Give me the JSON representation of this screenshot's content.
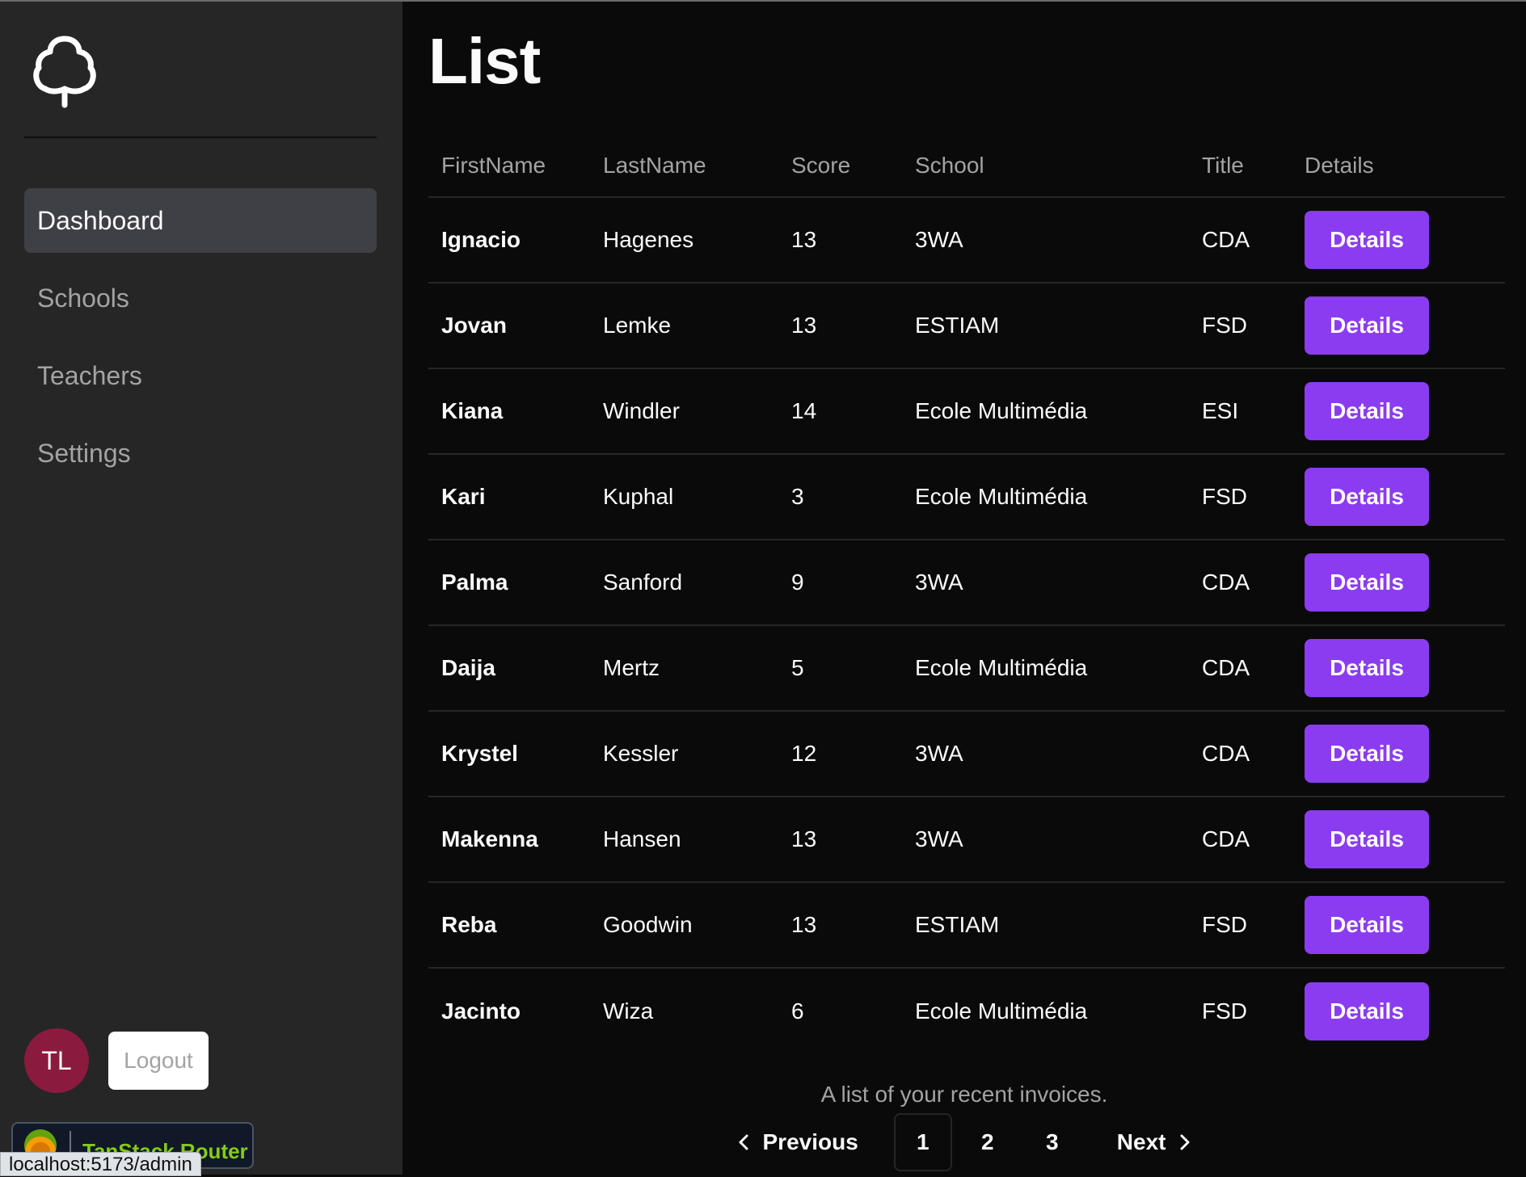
{
  "sidebar": {
    "logo_icon": "tree-icon",
    "nav": [
      {
        "label": "Dashboard",
        "active": true
      },
      {
        "label": "Schools",
        "active": false
      },
      {
        "label": "Teachers",
        "active": false
      },
      {
        "label": "Settings",
        "active": false
      }
    ],
    "avatar_initials": "TL",
    "logout_label": "Logout",
    "devtools_label": "TanStack Router",
    "status_url": "localhost:5173/admin"
  },
  "main": {
    "title": "List",
    "table": {
      "headers": [
        "FirstName",
        "LastName",
        "Score",
        "School",
        "Title",
        "Details"
      ],
      "rows": [
        {
          "first": "Ignacio",
          "last": "Hagenes",
          "score": "13",
          "school": "3WA",
          "title": "CDA",
          "button": "Details"
        },
        {
          "first": "Jovan",
          "last": "Lemke",
          "score": "13",
          "school": "ESTIAM",
          "title": "FSD",
          "button": "Details"
        },
        {
          "first": "Kiana",
          "last": "Windler",
          "score": "14",
          "school": "Ecole Multimédia",
          "title": "ESI",
          "button": "Details"
        },
        {
          "first": "Kari",
          "last": "Kuphal",
          "score": "3",
          "school": "Ecole Multimédia",
          "title": "FSD",
          "button": "Details"
        },
        {
          "first": "Palma",
          "last": "Sanford",
          "score": "9",
          "school": "3WA",
          "title": "CDA",
          "button": "Details"
        },
        {
          "first": "Daija",
          "last": "Mertz",
          "score": "5",
          "school": "Ecole Multimédia",
          "title": "CDA",
          "button": "Details"
        },
        {
          "first": "Krystel",
          "last": "Kessler",
          "score": "12",
          "school": "3WA",
          "title": "CDA",
          "button": "Details"
        },
        {
          "first": "Makenna",
          "last": "Hansen",
          "score": "13",
          "school": "3WA",
          "title": "CDA",
          "button": "Details"
        },
        {
          "first": "Reba",
          "last": "Goodwin",
          "score": "13",
          "school": "ESTIAM",
          "title": "FSD",
          "button": "Details"
        },
        {
          "first": "Jacinto",
          "last": "Wiza",
          "score": "6",
          "school": "Ecole Multimédia",
          "title": "FSD",
          "button": "Details"
        }
      ],
      "caption": "A list of your recent invoices."
    },
    "pagination": {
      "previous_label": "Previous",
      "next_label": "Next",
      "pages": [
        "1",
        "2",
        "3"
      ],
      "current_page": "1"
    }
  },
  "colors": {
    "accent": "#8b3cf0",
    "sidebar_bg": "#262626",
    "main_bg": "#0a0a0a",
    "avatar_bg": "#8b1a3f"
  }
}
